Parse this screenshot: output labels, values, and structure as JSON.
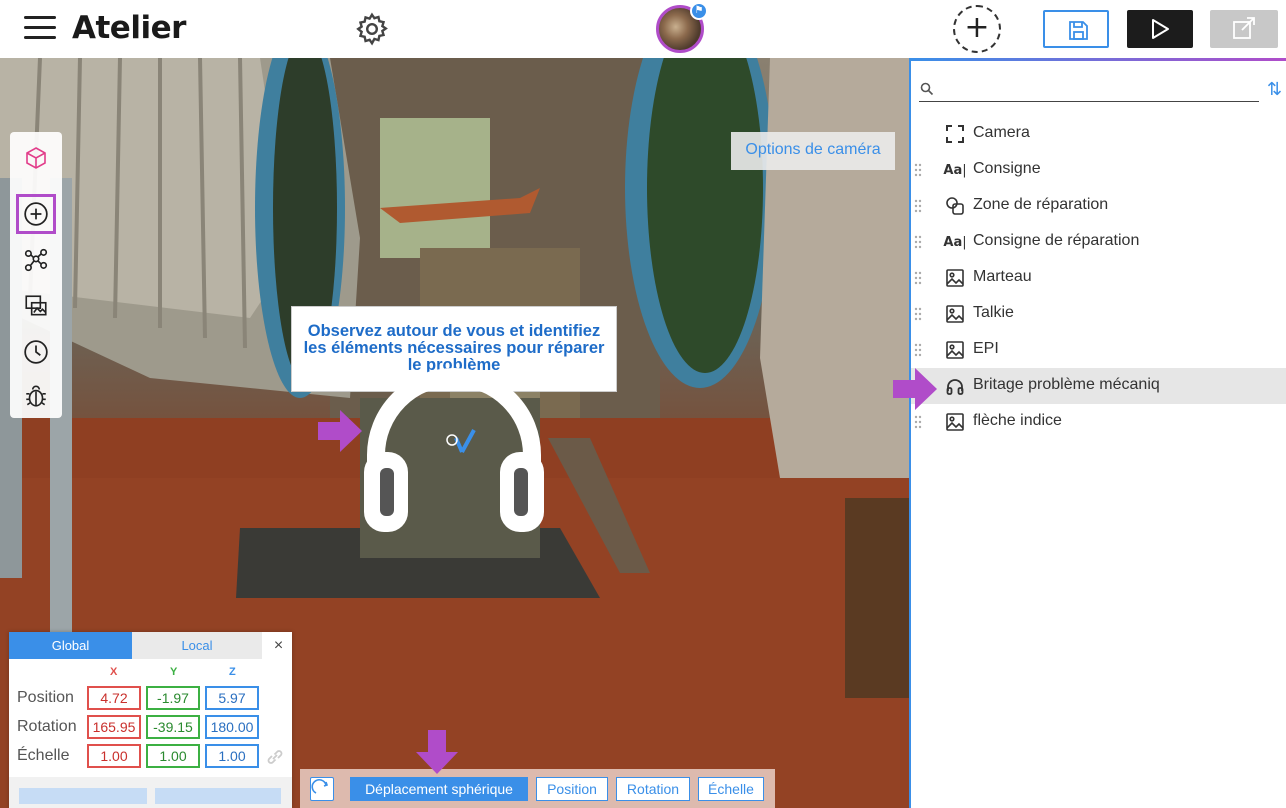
{
  "app": {
    "title": "Atelier"
  },
  "camera_options_label": "Options de caméra",
  "instruction_text": "Observez autour de vous et identifiez les éléments nécessaires pour réparer le problème",
  "transform": {
    "tabs": {
      "global": "Global",
      "local": "Local"
    },
    "close": "×",
    "axes": {
      "x": "X",
      "y": "Y",
      "z": "Z"
    },
    "rows": {
      "position": {
        "label": "Position",
        "x": "4.72",
        "y": "-1.97",
        "z": "5.97"
      },
      "rotation": {
        "label": "Rotation",
        "x": "165.95",
        "y": "-39.15",
        "z": "180.00"
      },
      "scale": {
        "label": "Échelle",
        "x": "1.00",
        "y": "1.00",
        "z": "1.00"
      }
    }
  },
  "modes": {
    "spherical": "Déplacement sphérique",
    "position": "Position",
    "rotation": "Rotation",
    "scale": "Échelle"
  },
  "search": {
    "value": "",
    "placeholder": ""
  },
  "objects": [
    {
      "label": "Camera",
      "icon": "camera-frame-icon"
    },
    {
      "label": "Consigne",
      "icon": "text-icon"
    },
    {
      "label": "Zone de réparation",
      "icon": "shapes-icon"
    },
    {
      "label": "Consigne de réparation",
      "icon": "text-icon"
    },
    {
      "label": "Marteau",
      "icon": "image-icon"
    },
    {
      "label": "Talkie",
      "icon": "image-icon"
    },
    {
      "label": "EPI",
      "icon": "image-icon"
    },
    {
      "label": "Britage problème mécaniq",
      "icon": "headphones-icon",
      "selected": true
    },
    {
      "label": "flèche indice",
      "icon": "image-icon"
    }
  ],
  "colors": {
    "accent": "#3a8fe8",
    "highlight": "#b04cc9",
    "x_axis": "#e0504c",
    "y_axis": "#3cb043",
    "z_axis": "#3a8fe8"
  }
}
